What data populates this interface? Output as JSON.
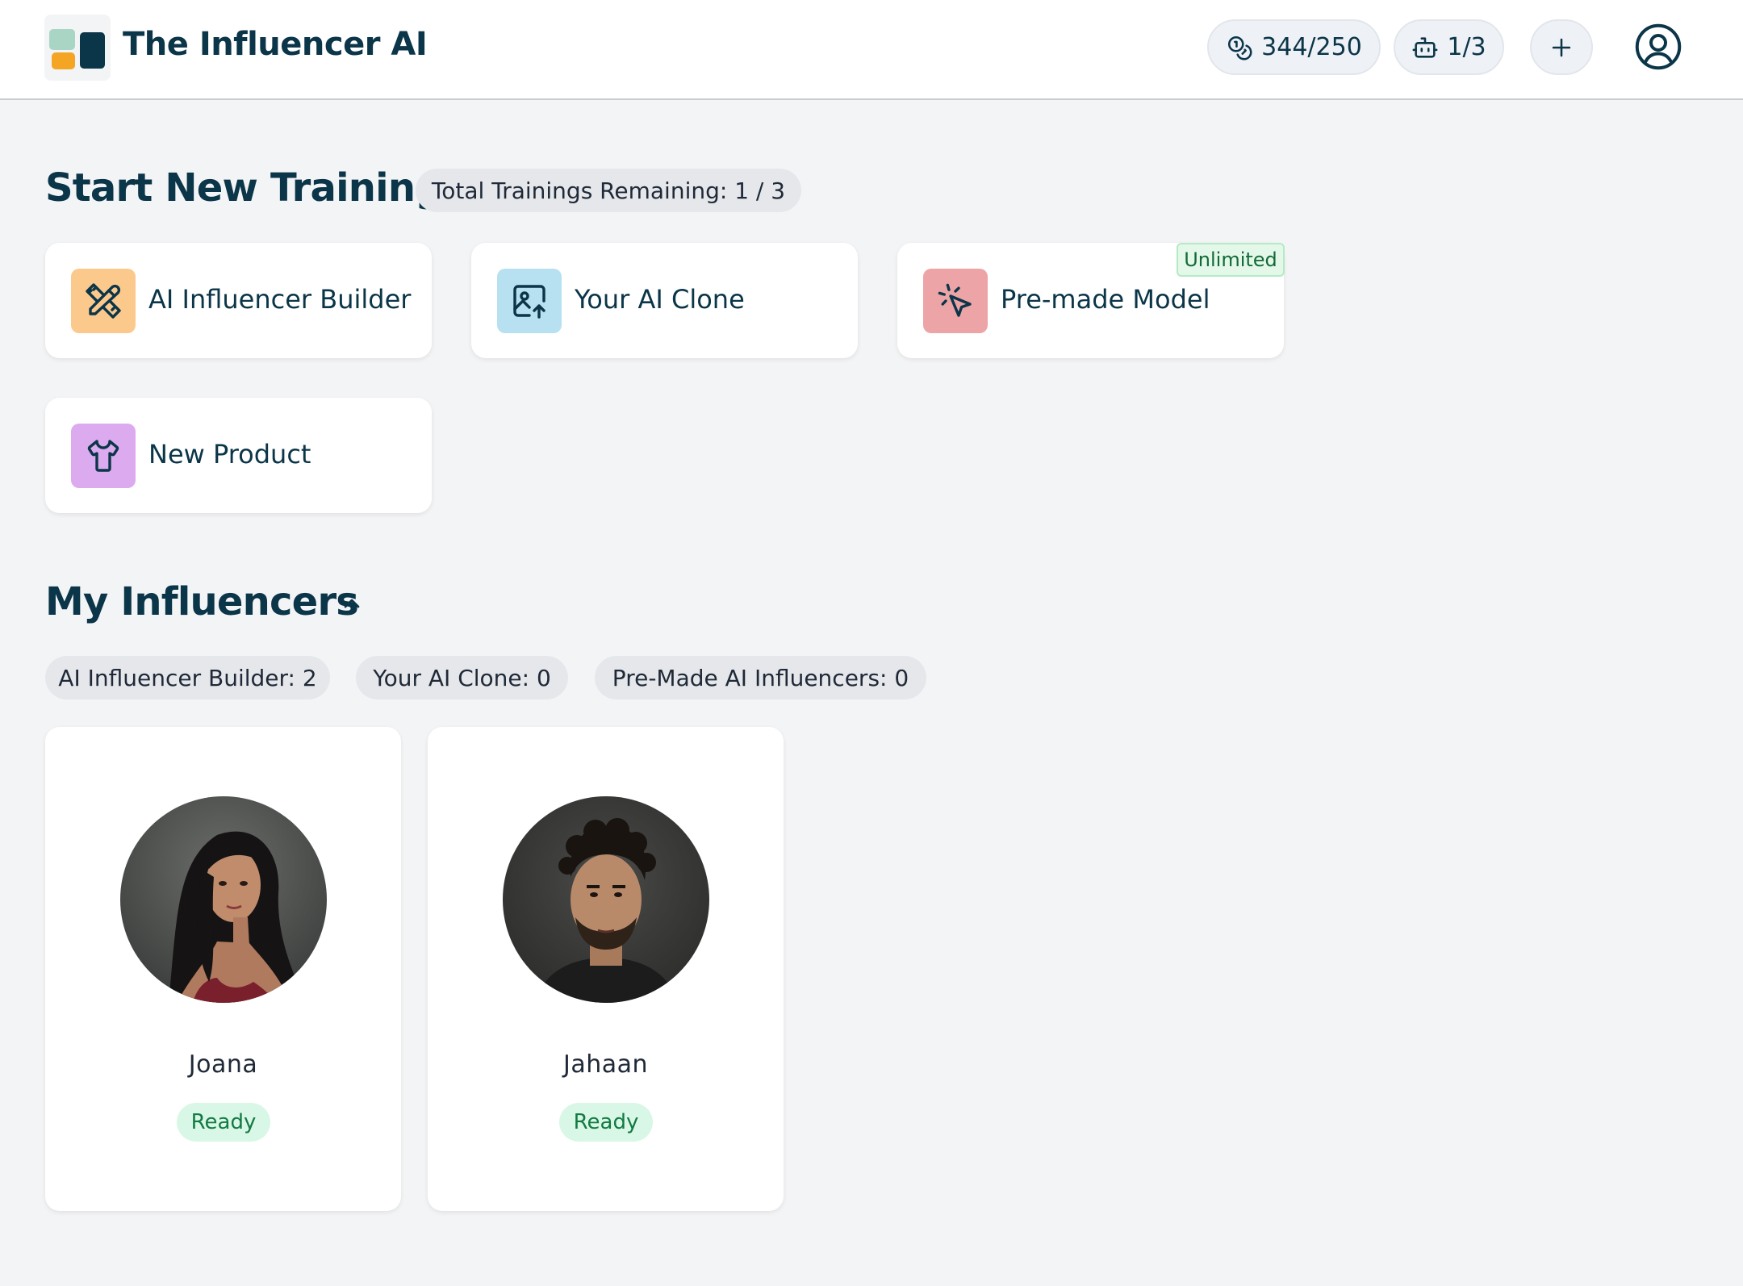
{
  "header": {
    "brand": "The Influencer AI",
    "credits": "344/250",
    "models": "1/3",
    "add_label": "+"
  },
  "training": {
    "title": "Start New Training",
    "remaining": "Total Trainings Remaining: 1 / 3",
    "options": [
      {
        "label": "AI Influencer Builder",
        "icon": "tools-icon",
        "color": "#fcc98c"
      },
      {
        "label": "Your AI Clone",
        "icon": "image-upload-icon",
        "color": "#b7e1f0"
      },
      {
        "label": "Pre-made Model",
        "icon": "cursor-click-icon",
        "color": "#eda4a6",
        "badge": "Unlimited"
      },
      {
        "label": "New Product",
        "icon": "shirt-icon",
        "color": "#dcaaee"
      }
    ]
  },
  "influencers": {
    "title": "My Influencers",
    "filters": [
      "AI Influencer Builder: 2",
      "Your AI Clone: 0",
      "Pre-Made AI Influencers: 0"
    ],
    "items": [
      {
        "name": "Joana",
        "status": "Ready"
      },
      {
        "name": "Jahaan",
        "status": "Ready"
      }
    ]
  },
  "colors": {
    "primary": "#0b3548",
    "ready_bg": "#d9f7e6",
    "ready_text": "#137a44",
    "background": "#f3f4f6"
  }
}
